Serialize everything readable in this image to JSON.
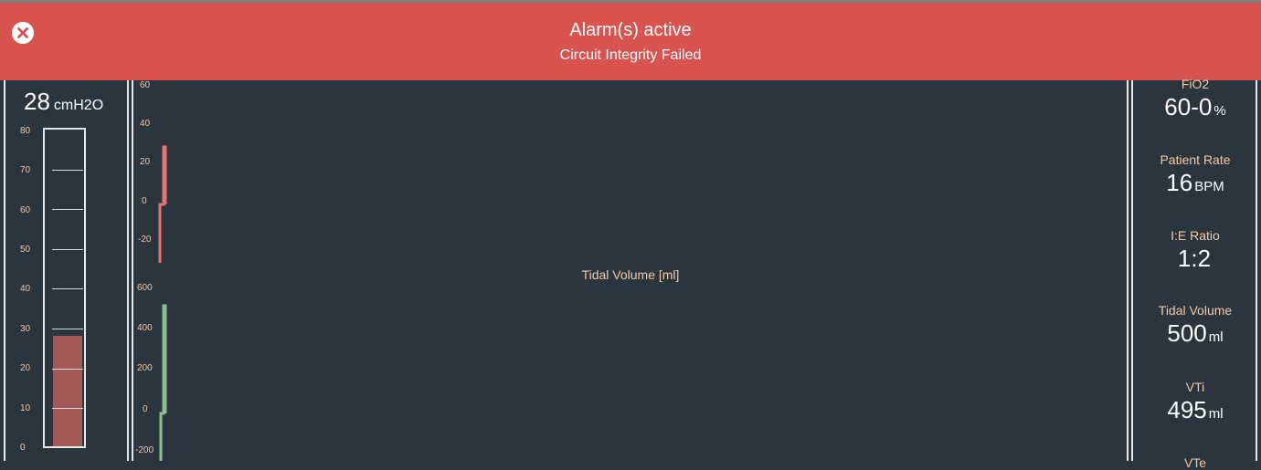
{
  "alarm": {
    "title": "Alarm(s) active",
    "message": "Circuit Integrity Failed",
    "color": "#d9534f"
  },
  "pressure": {
    "value": "28",
    "unit": "cmH2O",
    "level": 28,
    "scale_max": 80,
    "scale_labels": [
      "80",
      "70",
      "60",
      "50",
      "40",
      "30",
      "20",
      "10",
      "0"
    ]
  },
  "graphs": {
    "pressure_axis": [
      "60",
      "40",
      "20",
      "0",
      "-20"
    ],
    "volume_axis": [
      "600",
      "400",
      "200",
      "0",
      "-200"
    ],
    "volume_title": "Tidal Volume [ml]",
    "pressure_color": "#e57373",
    "volume_color": "#8fbf8f"
  },
  "readouts": [
    {
      "label": "FiO2",
      "value": "60-0",
      "unit": "%"
    },
    {
      "label": "Patient Rate",
      "value": "16",
      "unit": "BPM"
    },
    {
      "label": "I:E Ratio",
      "value": "1:2",
      "unit": ""
    },
    {
      "label": "Tidal Volume",
      "value": "500",
      "unit": "ml"
    },
    {
      "label": "VTi",
      "value": "495",
      "unit": "ml"
    },
    {
      "label": "VTe",
      "value": "",
      "unit": ""
    }
  ],
  "icons": {
    "close": "close-circle-icon"
  }
}
